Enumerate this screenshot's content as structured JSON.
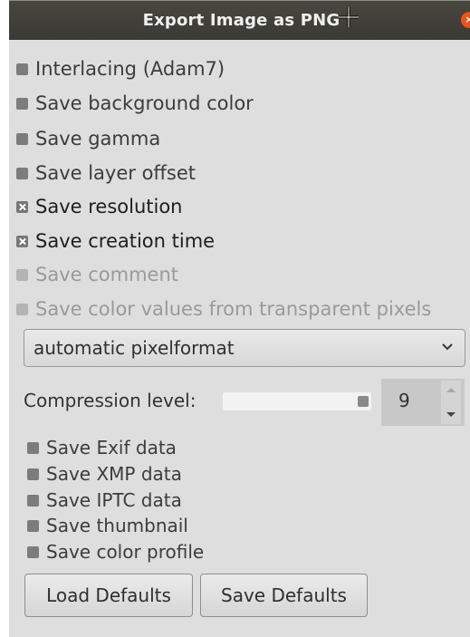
{
  "dialog": {
    "title": "Export Image as PNG",
    "close_label": "×"
  },
  "options": [
    {
      "label": "Interlacing (Adam7)",
      "checked": false,
      "disabled": false
    },
    {
      "label": "Save background color",
      "checked": false,
      "disabled": false
    },
    {
      "label": "Save gamma",
      "checked": false,
      "disabled": false
    },
    {
      "label": "Save layer offset",
      "checked": false,
      "disabled": false
    },
    {
      "label": "Save resolution",
      "checked": true,
      "disabled": false
    },
    {
      "label": "Save creation time",
      "checked": true,
      "disabled": false
    },
    {
      "label": "Save comment",
      "checked": false,
      "disabled": true
    },
    {
      "label": "Save color values from transparent pixels",
      "checked": false,
      "disabled": true
    }
  ],
  "pixelformat": {
    "selected": "automatic pixelformat"
  },
  "compression": {
    "label": "Compression level:",
    "value": "9",
    "slider_fraction": 1.0
  },
  "metadata_options": [
    {
      "label": "Save Exif data",
      "checked": false
    },
    {
      "label": "Save XMP data",
      "checked": false
    },
    {
      "label": "Save IPTC data",
      "checked": false
    },
    {
      "label": "Save thumbnail",
      "checked": false
    },
    {
      "label": "Save color profile",
      "checked": false
    }
  ],
  "buttons": {
    "load_defaults": "Load Defaults",
    "save_defaults": "Save Defaults"
  },
  "colors": {
    "titlebar": "#3f3e39",
    "close": "#e95420",
    "dialog_bg": "#dedede"
  }
}
